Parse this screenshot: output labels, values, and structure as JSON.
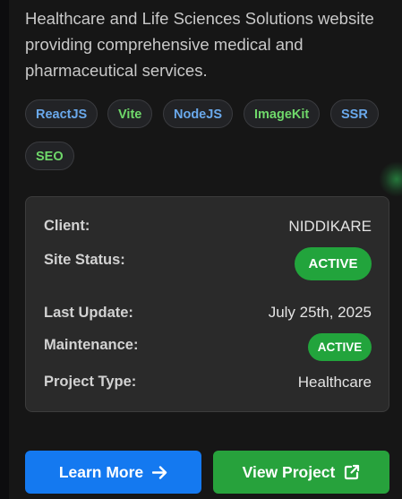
{
  "project": {
    "description": "Healthcare and Life Sciences Solutions website providing comprehensive medical and pharmaceutical services."
  },
  "tags": [
    {
      "label": "ReactJS",
      "color": "blue"
    },
    {
      "label": "Vite",
      "color": "green"
    },
    {
      "label": "NodeJS",
      "color": "blue"
    },
    {
      "label": "ImageKit",
      "color": "green"
    },
    {
      "label": "SSR",
      "color": "blue"
    },
    {
      "label": "SEO",
      "color": "green"
    }
  ],
  "details": {
    "client_label": "Client:",
    "client_value": "NIDDIKARE",
    "site_status_label": "Site Status:",
    "site_status_value": "ACTIVE",
    "last_update_label": "Last Update:",
    "last_update_value": "July 25th, 2025",
    "maintenance_label": "Maintenance:",
    "maintenance_value": "ACTIVE",
    "project_type_label": "Project Type:",
    "project_type_value": "Healthcare"
  },
  "actions": {
    "learn_more_label": "Learn More",
    "learn_more_icon": "arrow-right-icon",
    "view_project_label": "View Project",
    "view_project_icon": "external-link-icon"
  },
  "colors": {
    "tag_blue": "#6aa9ec",
    "tag_green": "#6fd86a",
    "status_green": "#22a43c",
    "button_blue": "#1479f0",
    "button_green": "#27a23c"
  }
}
